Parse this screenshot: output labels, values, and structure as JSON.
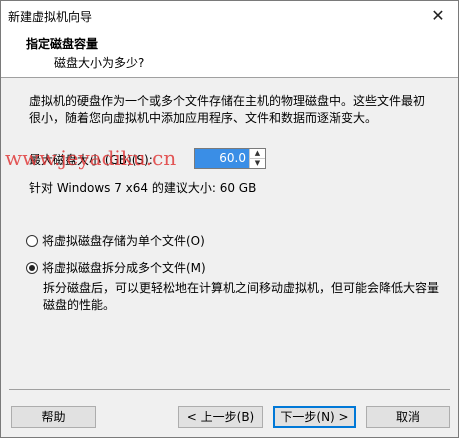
{
  "window": {
    "title": "新建虚拟机向导",
    "close_icon": "close-icon"
  },
  "header": {
    "title": "指定磁盘容量",
    "subtitle": "磁盘大小为多少?"
  },
  "description": "虚拟机的硬盘作为一个或多个文件存储在主机的物理磁盘中。这些文件最初很小，随着您向虚拟机中添加应用程序、文件和数据而逐渐变大。",
  "size_field": {
    "label": "最大磁盘大小 (GB)(S):",
    "value": "60.0"
  },
  "recommend": "针对 Windows 7 x64 的建议大小: 60 GB",
  "radio_single": {
    "label": "将虚拟磁盘存储为单个文件(O)",
    "checked": false
  },
  "radio_multi": {
    "label": "将虚拟磁盘拆分成多个文件(M)",
    "checked": true
  },
  "note": "拆分磁盘后，可以更轻松地在计算机之间移动虚拟机，但可能会降低大容量磁盘的性能。",
  "buttons": {
    "help": "帮助",
    "back": "< 上一步(B)",
    "next": "下一步(N) >",
    "cancel": "取消"
  },
  "watermark": "www.jeyadiku.cn",
  "colors": {
    "selection": "#3a8ee6",
    "watermark": "#e03a3a",
    "default_button_border": "#0078d7"
  }
}
